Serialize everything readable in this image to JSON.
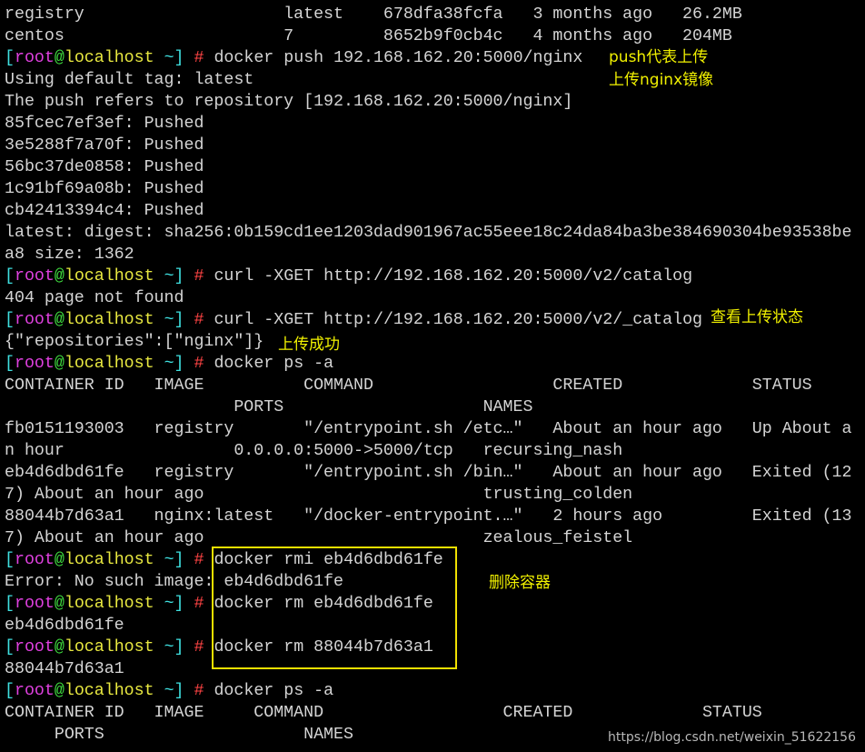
{
  "prompt": {
    "open": "[",
    "user": "root",
    "at": "@",
    "host": "localhost",
    "close": " ~]",
    "hash": " # "
  },
  "colors": {
    "background": "#000000",
    "text": "#d4d4d4",
    "bracket": "#3fe0e0",
    "user": "#e040e0",
    "at": "#40e040",
    "host": "#e8e840",
    "hash": "#ff4444",
    "annotation": "#f0f000"
  },
  "lines": [
    {
      "text": "registry                    latest    678dfa38fcfa   3 months ago   26.2MB"
    },
    {
      "text": "centos                      7         8652b9f0cb4c   4 months ago   204MB"
    },
    {
      "prompt": true,
      "text": "docker push 192.168.162.20:5000/nginx"
    },
    {
      "text": "Using default tag: latest"
    },
    {
      "text": "The push refers to repository [192.168.162.20:5000/nginx]"
    },
    {
      "text": "85fcec7ef3ef: Pushed"
    },
    {
      "text": "3e5288f7a70f: Pushed"
    },
    {
      "text": "56bc37de0858: Pushed"
    },
    {
      "text": "1c91bf69a08b: Pushed"
    },
    {
      "text": "cb42413394c4: Pushed"
    },
    {
      "text": "latest: digest: sha256:0b159cd1ee1203dad901967ac55eee18c24da84ba3be384690304be93538be"
    },
    {
      "text": "a8 size: 1362"
    },
    {
      "prompt": true,
      "text": "curl -XGET http://192.168.162.20:5000/v2/catalog"
    },
    {
      "text": "404 page not found"
    },
    {
      "prompt": true,
      "text": "curl -XGET http://192.168.162.20:5000/v2/_catalog"
    },
    {
      "text": "{\"repositories\":[\"nginx\"]}"
    },
    {
      "prompt": true,
      "text": "docker ps -a"
    },
    {
      "text": "CONTAINER ID   IMAGE          COMMAND                  CREATED             STATUS"
    },
    {
      "text": "                       PORTS                    NAMES"
    },
    {
      "text": "fb0151193003   registry       \"/entrypoint.sh /etc…\"   About an hour ago   Up About a"
    },
    {
      "text": "n hour                 0.0.0.0:5000->5000/tcp   recursing_nash"
    },
    {
      "text": "eb4d6dbd61fe   registry       \"/entrypoint.sh /bin…\"   About an hour ago   Exited (12"
    },
    {
      "text": "7) About an hour ago                            trusting_colden"
    },
    {
      "text": "88044b7d63a1   nginx:latest   \"/docker-entrypoint.…\"   2 hours ago         Exited (13"
    },
    {
      "text": "7) About an hour ago                            zealous_feistel"
    },
    {
      "prompt": true,
      "text": "docker rmi eb4d6dbd61fe"
    },
    {
      "text": "Error: No such image: eb4d6dbd61fe"
    },
    {
      "prompt": true,
      "text": "docker rm eb4d6dbd61fe"
    },
    {
      "text": "eb4d6dbd61fe"
    },
    {
      "prompt": true,
      "text": "docker rm 88044b7d63a1"
    },
    {
      "text": "88044b7d63a1"
    },
    {
      "prompt": true,
      "text": "docker ps -a"
    },
    {
      "text": "CONTAINER ID   IMAGE     COMMAND                  CREATED             STATUS"
    },
    {
      "text": "     PORTS                    NAMES"
    }
  ],
  "annotations": {
    "push_meaning": "push代表上传",
    "push_nginx": "上传nginx镜像",
    "check_status": "查看上传状态",
    "upload_success": "上传成功",
    "delete_container": "删除容器"
  },
  "watermark": "https://blog.csdn.net/weixin_51622156"
}
